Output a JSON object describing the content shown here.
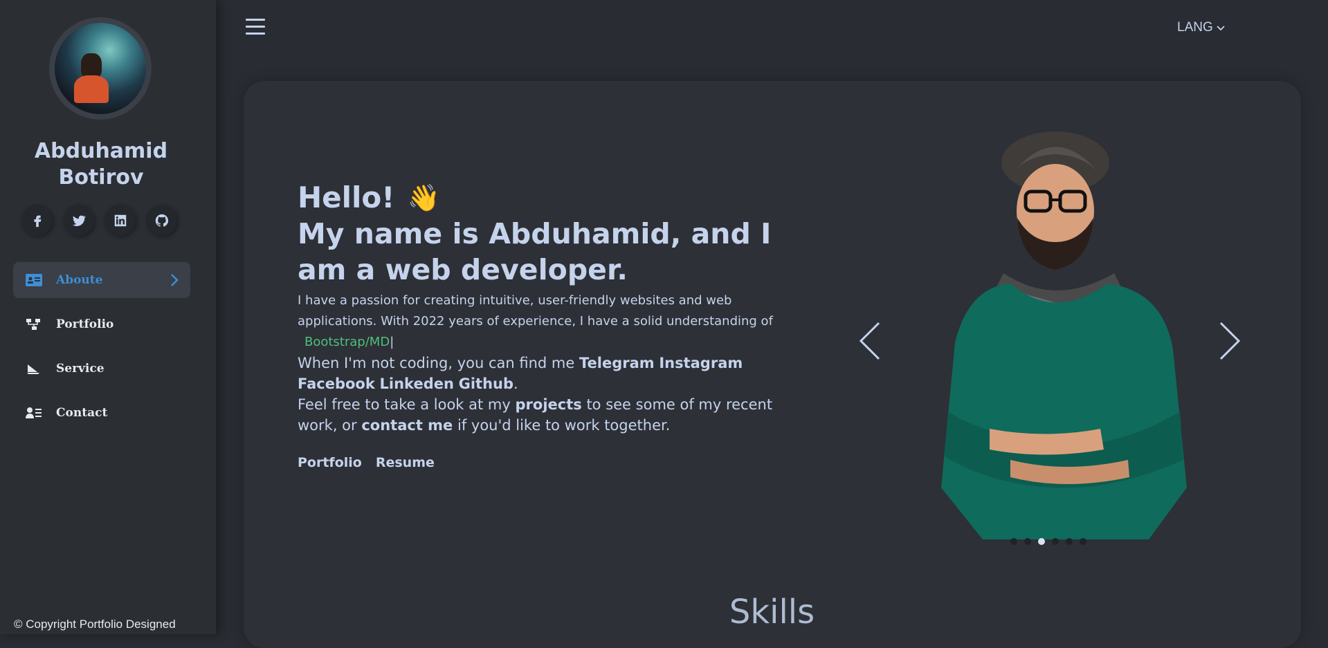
{
  "sidebar": {
    "name_first": "Abduhamid",
    "name_last": "Botirov",
    "socials": [
      {
        "icon": "facebook-icon"
      },
      {
        "icon": "twitter-icon"
      },
      {
        "icon": "linkedin-icon"
      },
      {
        "icon": "github-icon"
      }
    ],
    "nav": [
      {
        "label": "Aboute",
        "icon": "id-card-icon",
        "active": true
      },
      {
        "label": "Portfolio",
        "icon": "sitemap-icon"
      },
      {
        "label": "Service",
        "icon": "sail-icon"
      },
      {
        "label": "Contact",
        "icon": "contact-list-icon"
      }
    ],
    "copyright": "© Copyright Portfolio Designed"
  },
  "topbar": {
    "lang": "LANG",
    "lang_icon": "chevron-down-icon",
    "theme_icon": "moon-icon",
    "menu_icon": "hamburger-icon"
  },
  "hero": {
    "hello": "Hello!",
    "wave": "👋",
    "headline": "My name is Abduhamid, and I am a web developer.",
    "intro": "I have a passion for creating intuitive, user-friendly websites and web applications. With 2022 years of experience, I have a solid understanding of",
    "tech": "Bootstrap/MD",
    "cursor": "|",
    "social_prefix": "When I'm not coding, you can find me",
    "social_links": [
      "Telegram",
      "Instagram",
      "Facebook",
      "Linkeden",
      "Github"
    ],
    "social_suffix": ".",
    "feel_prefix": "Feel free to take a look at my",
    "projects": "projects",
    "feel_mid": "to see some of my recent work, or",
    "contact": "contact me",
    "feel_suffix": "if you'd like to work together.",
    "buttons": [
      "Portfolio",
      "Resume"
    ]
  },
  "carousel": {
    "slides": 6,
    "active_index": 2
  },
  "skills_heading": "Skills",
  "colors": {
    "background": "#292c32",
    "text": "#c5d3ec",
    "accent": "#3e8fd6",
    "tech": "#4ec07c"
  }
}
